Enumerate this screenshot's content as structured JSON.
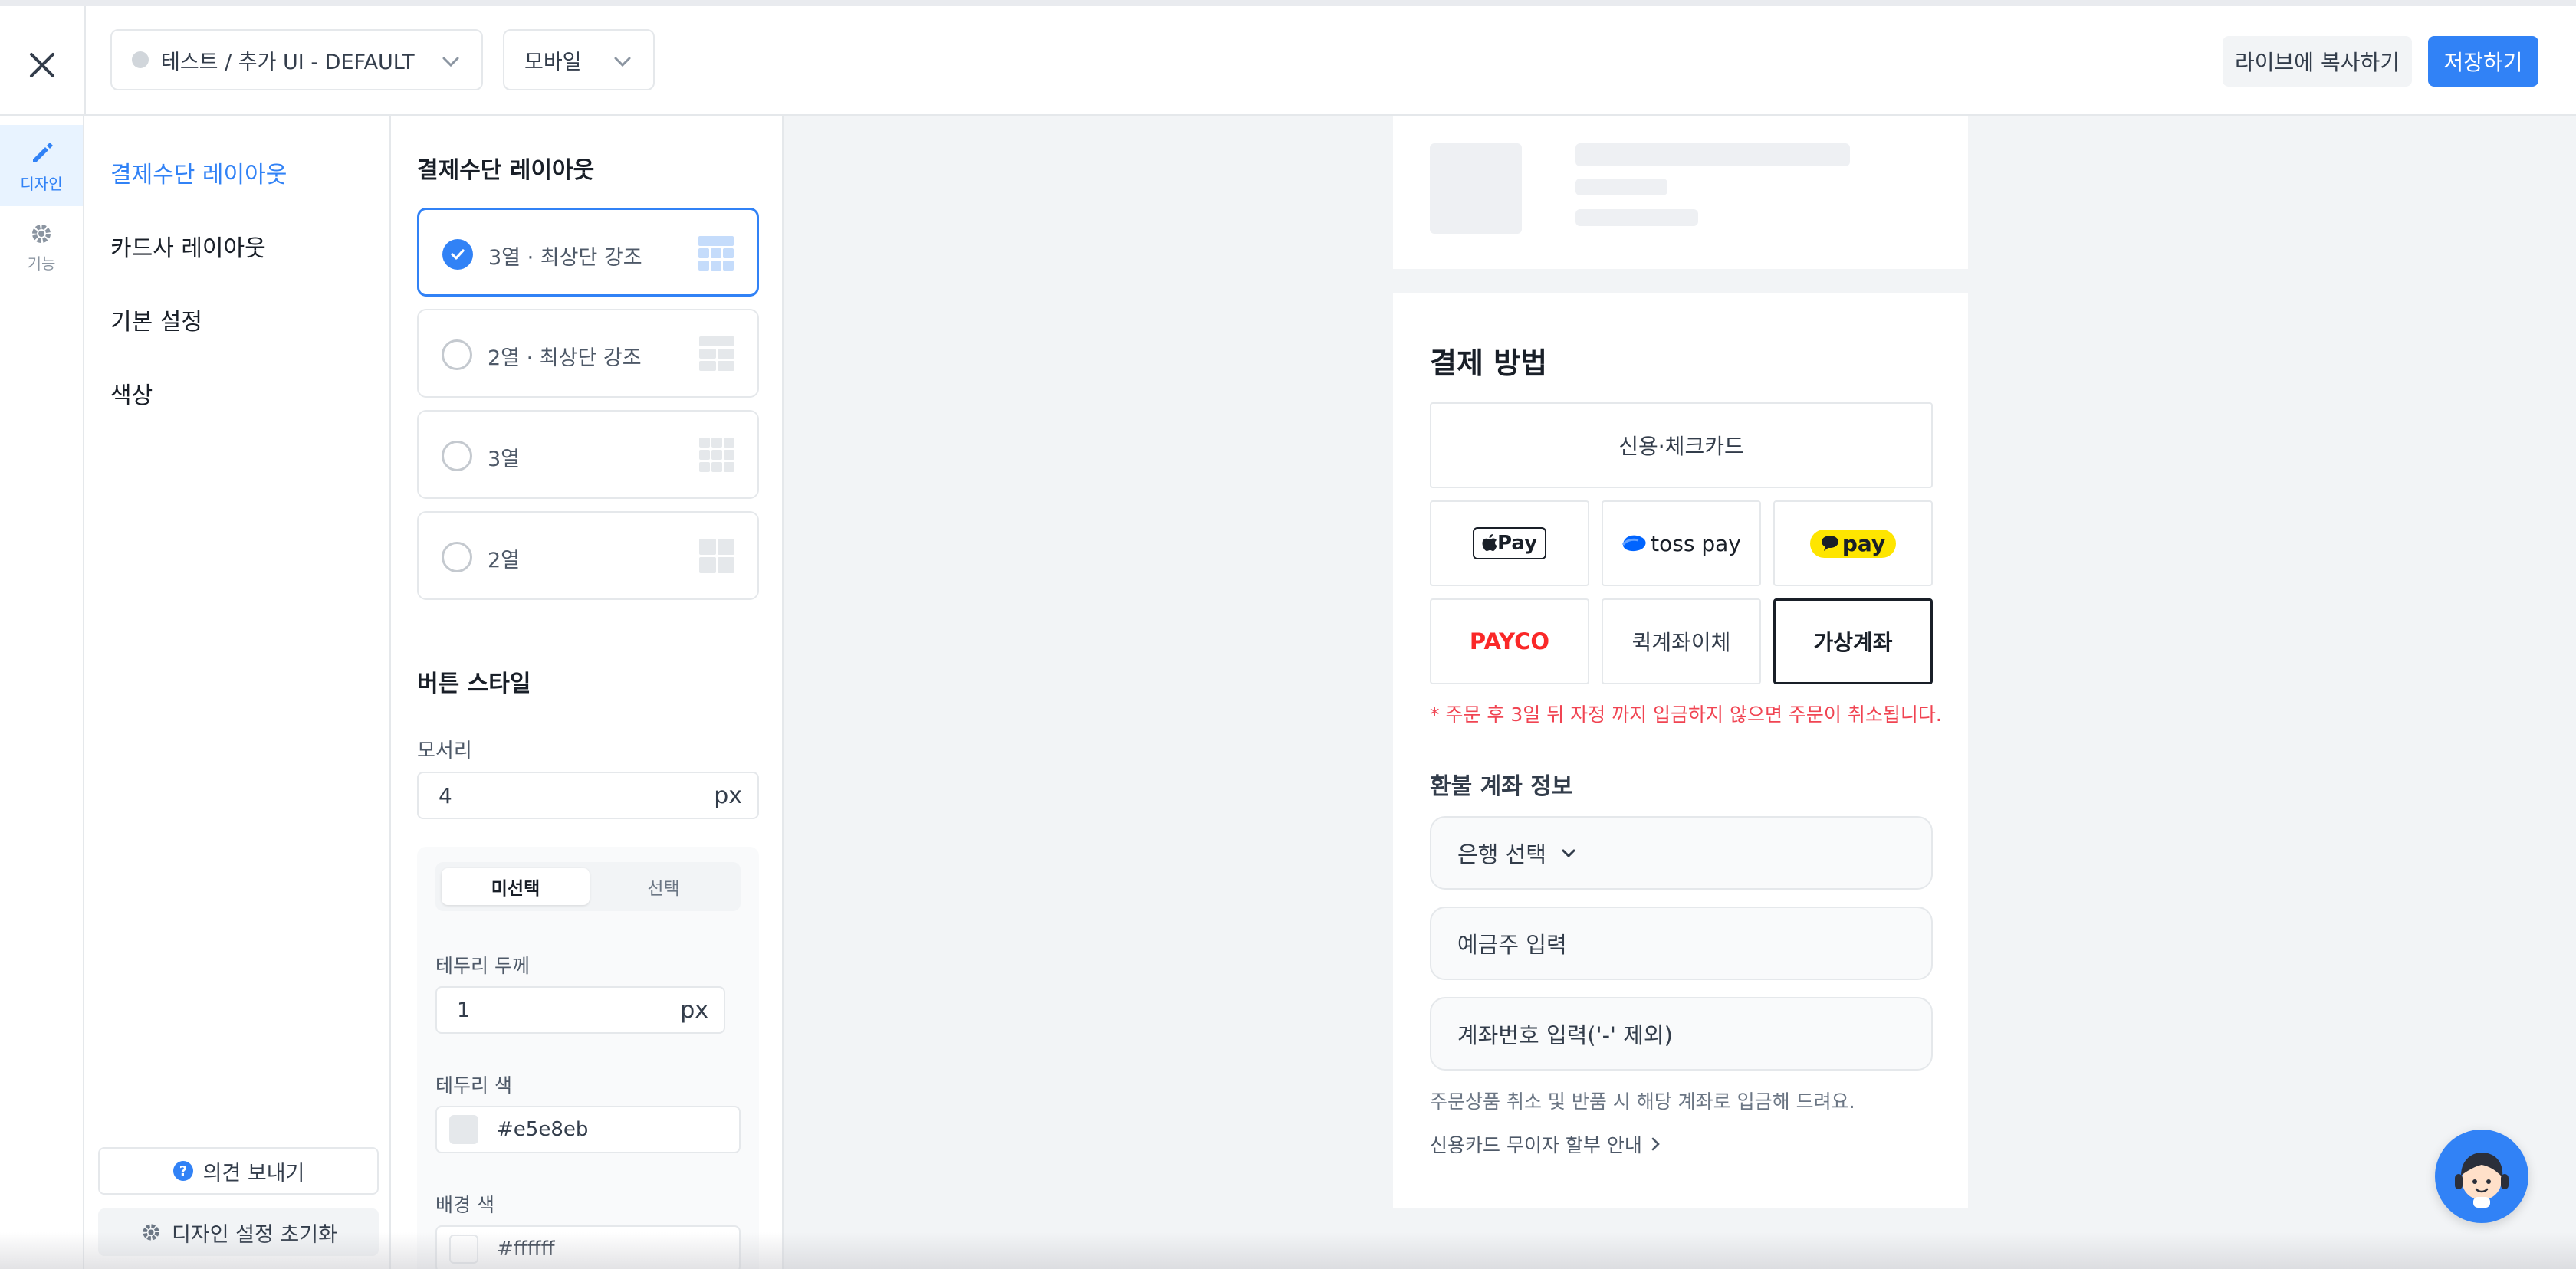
{
  "header": {
    "project_select": "테스트 / 추가 UI - DEFAULT",
    "device_select": "모바일",
    "copy_live_label": "라이브에 복사하기",
    "save_label": "저장하기"
  },
  "rail": {
    "items": [
      {
        "label": "디자인",
        "icon": "pencil-icon",
        "active": true
      },
      {
        "label": "기능",
        "icon": "gear-icon",
        "active": false
      }
    ]
  },
  "menu": {
    "items": [
      {
        "label": "결제수단 레이아웃",
        "active": true
      },
      {
        "label": "카드사 레이아웃",
        "active": false
      },
      {
        "label": "기본 설정",
        "active": false
      },
      {
        "label": "색상",
        "active": false
      }
    ],
    "feedback_label": "의견 보내기",
    "reset_label": "디자인 설정 초기화"
  },
  "settings": {
    "layout_title": "결제수단 레이아웃",
    "layout_options": [
      {
        "label": "3열 · 최상단 강조",
        "selected": true
      },
      {
        "label": "2열 · 최상단 강조",
        "selected": false
      },
      {
        "label": "3열",
        "selected": false
      },
      {
        "label": "2열",
        "selected": false
      }
    ],
    "button_style_title": "버튼 스타일",
    "corner_label": "모서리",
    "corner_value": "4",
    "unit_px": "px",
    "tab_unselected": "미선택",
    "tab_selected": "선택",
    "border_width_label": "테두리 두께",
    "border_width_value": "1",
    "border_color_label": "테두리 색",
    "border_color_value": "#e5e8eb",
    "bg_color_label": "배경 색",
    "bg_color_value": "#ffffff"
  },
  "preview": {
    "pay_title": "결제 방법",
    "methods": {
      "card": "신용·체크카드",
      "applepay": "Pay",
      "tosspay": "toss pay",
      "kakaopay": "pay",
      "payco": "PAYCO",
      "quick_transfer": "퀵계좌이체",
      "virtual_account": "가상계좌"
    },
    "notice": "* 주문 후 3일 뒤 자정 까지 입금하지 않으면 주문이 취소됩니다.",
    "refund_title": "환불 계좌 정보",
    "bank_select": "은행 선택",
    "holder_placeholder": "예금주 입력",
    "account_placeholder": "계좌번호 입력('-' 제외)",
    "refund_help": "주문상품 취소 및 반품 시 해당 계좌로 입금해 드려요.",
    "installment_link": "신용카드 무이자 할부 안내"
  },
  "colors": {
    "accent": "#3182f6",
    "notice": "#f04452",
    "payco": "#fa2828",
    "kakao": "#fee500",
    "toss": "#0064ff"
  }
}
